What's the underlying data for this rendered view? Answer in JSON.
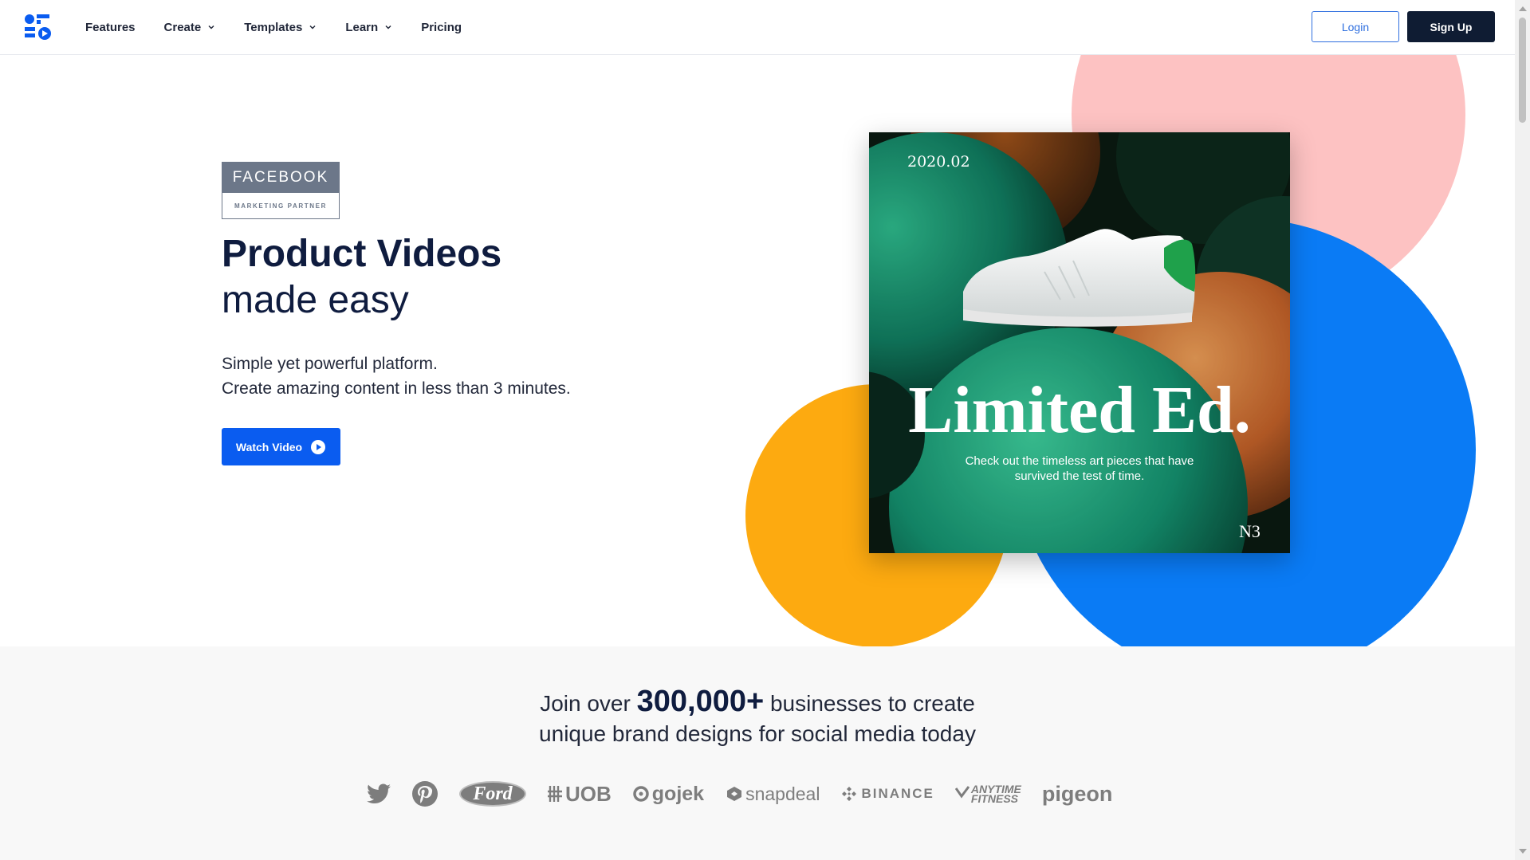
{
  "nav": {
    "items": [
      {
        "label": "Features",
        "dropdown": false
      },
      {
        "label": "Create",
        "dropdown": true
      },
      {
        "label": "Templates",
        "dropdown": true
      },
      {
        "label": "Learn",
        "dropdown": true
      },
      {
        "label": "Pricing",
        "dropdown": false
      }
    ],
    "login_label": "Login",
    "signup_label": "Sign Up"
  },
  "hero": {
    "badge_top": "FACEBOOK",
    "badge_bottom": "MARKETING PARTNER",
    "title_bold": "Product Videos",
    "title_light": "made easy",
    "subtitle_line1": "Simple yet powerful platform.",
    "subtitle_line2": "Create amazing content in less than 3 minutes.",
    "watch_label": "Watch Video"
  },
  "ad_card": {
    "date": "2020.02",
    "title": "Limited Ed.",
    "desc_line1": "Check out the timeless art pieces that have",
    "desc_line2": "survived the test of time.",
    "brand": "N3"
  },
  "proof": {
    "prefix": "Join over ",
    "count": "300,000+",
    "suffix": " businesses to create",
    "line2": "unique brand designs for social media today",
    "logos": {
      "ford": "Ford",
      "uob": "UOB",
      "gojek": "gojek",
      "snapdeal": "snapdeal",
      "binance": "BINANCE",
      "anytime1": "ANYTIME",
      "anytime2": "FITNESS",
      "pigeon": "pigeon"
    }
  },
  "colors": {
    "brand_blue": "#0a5cf0",
    "navy": "#0f1c33",
    "pink_circle": "#fdc2c2",
    "blue_circle": "#0a7bf5",
    "orange_circle": "#fdaa10",
    "logo_gray": "#7d7d7d"
  }
}
